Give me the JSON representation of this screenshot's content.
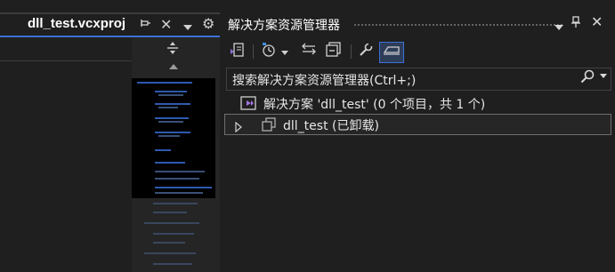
{
  "editor": {
    "tab_title": "dll_test.vcxproj"
  },
  "solution_explorer": {
    "title": "解决方案资源管理器",
    "search_placeholder": "搜索解决方案资源管理器(Ctrl+;)",
    "tree": {
      "solution_label": "解决方案 'dll_test' (0 个项目，共 1 个)",
      "project_label": "dll_test (已卸载)"
    }
  },
  "colors": {
    "background": "#1f1f1f",
    "accent": "#3e6fd6",
    "text": "#e6e6e6"
  }
}
